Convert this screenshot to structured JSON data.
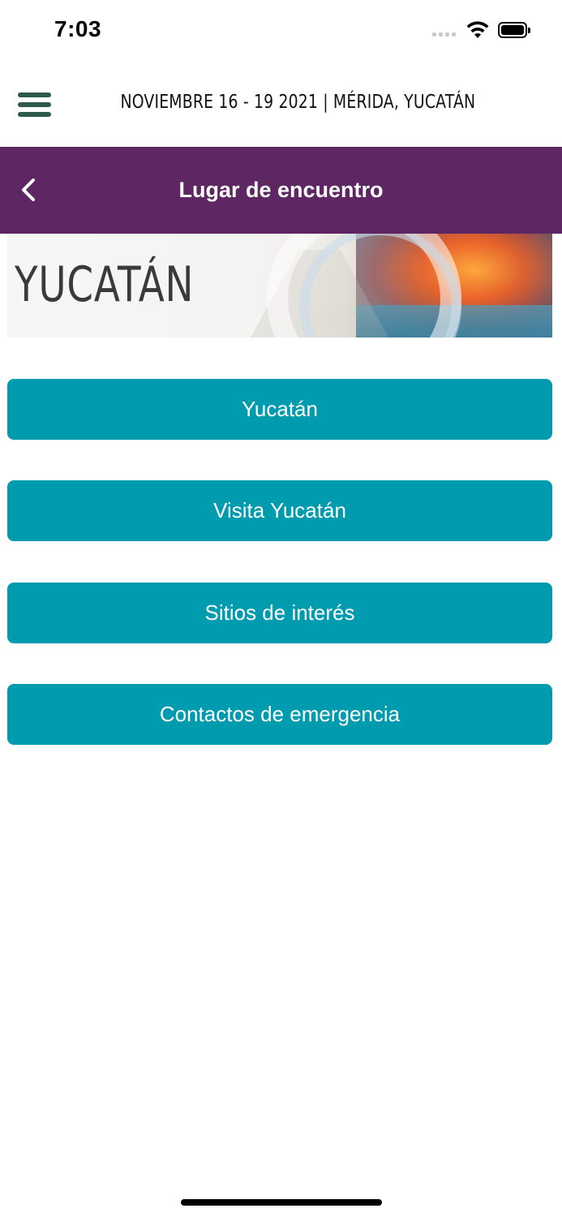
{
  "status_bar": {
    "time": "7:03"
  },
  "header": {
    "event_title": "NOVIEMBRE 16 - 19 2021 | MÉRIDA, YUCATÁN"
  },
  "nav": {
    "title": "Lugar de encuentro"
  },
  "banner": {
    "text": "YUCATÁN"
  },
  "menu": {
    "items": [
      {
        "label": "Yucatán"
      },
      {
        "label": "Visita Yucatán"
      },
      {
        "label": "Sitios de interés"
      },
      {
        "label": "Contactos de emergencia"
      }
    ]
  },
  "colors": {
    "nav_bar": "#5e2662",
    "button": "#009baf",
    "hamburger": "#2d5a4a"
  },
  "icons": {
    "menu": "hamburger-menu-icon",
    "back": "chevron-left-icon",
    "wifi": "wifi-icon",
    "battery": "battery-icon",
    "signal": "cellular-signal-icon"
  }
}
